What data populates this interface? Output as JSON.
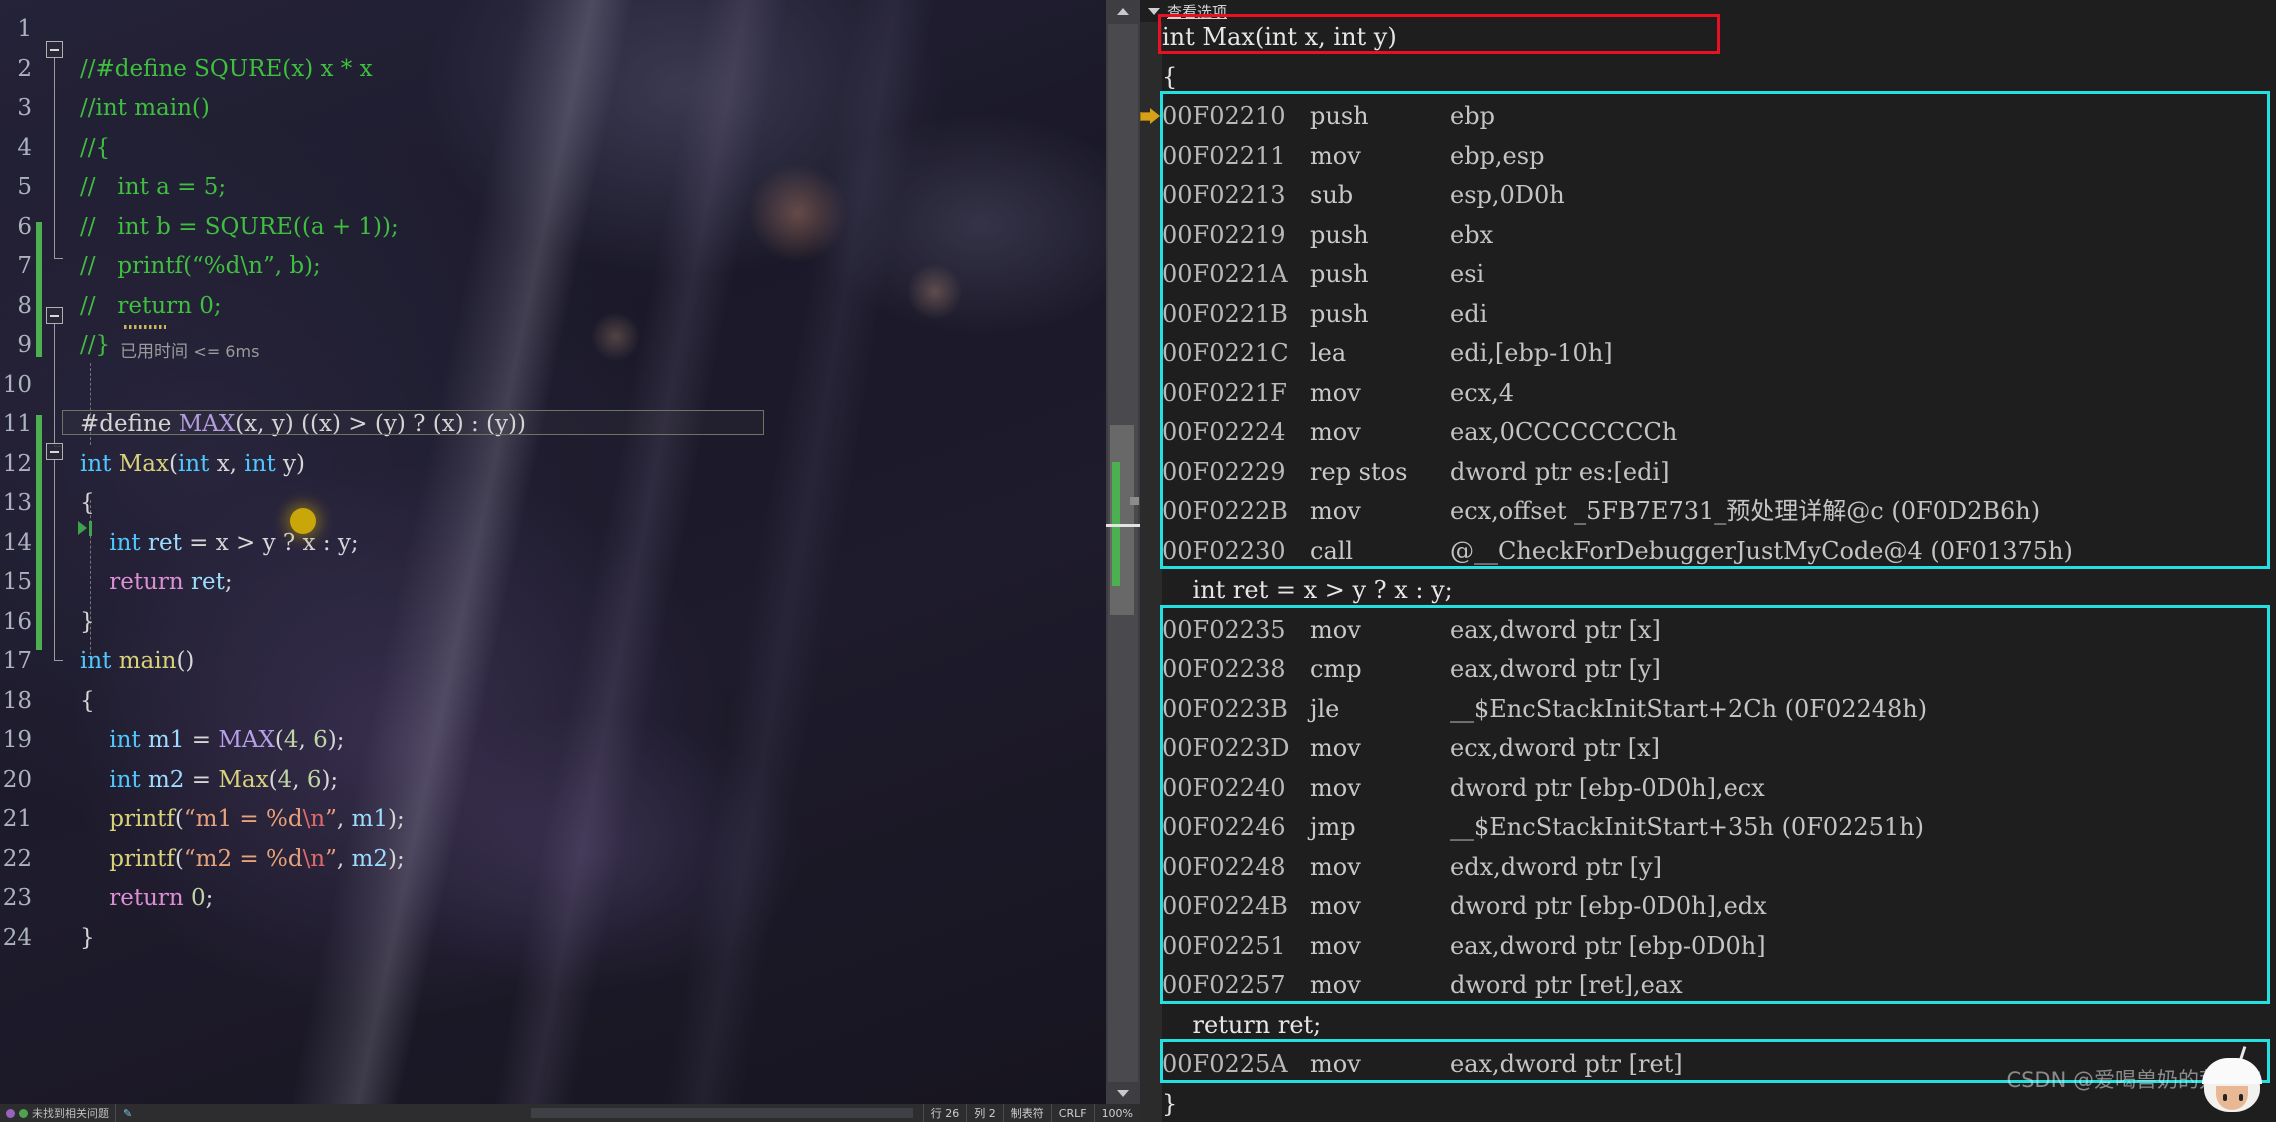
{
  "app": {
    "title": "Visual Studio Debugger",
    "accent_cyan": "#25e0e0",
    "accent_red": "#e81123",
    "change_bar_green": "#4caf50",
    "current_stmt_yellow": "#d8a018"
  },
  "editor": {
    "lines": [
      {
        "n": "1",
        "text": "",
        "tokens": []
      },
      {
        "n": "2",
        "tokens": [
          {
            "t": "//#define SQURE(x) x * x",
            "c": "cmt"
          }
        ]
      },
      {
        "n": "3",
        "tokens": [
          {
            "t": "//int main()",
            "c": "cmt"
          }
        ]
      },
      {
        "n": "4",
        "tokens": [
          {
            "t": "//{",
            "c": "cmt"
          }
        ]
      },
      {
        "n": "5",
        "tokens": [
          {
            "t": "//   int a = 5;",
            "c": "cmt"
          }
        ]
      },
      {
        "n": "6",
        "tokens": [
          {
            "t": "//   int b = SQURE((a + 1));",
            "c": "cmt"
          }
        ]
      },
      {
        "n": "7",
        "tokens": [
          {
            "t": "//   printf(“%d\\n”, b);",
            "c": "cmt"
          }
        ]
      },
      {
        "n": "8",
        "tokens": [
          {
            "t": "//   return 0;",
            "c": "cmt"
          }
        ]
      },
      {
        "n": "9",
        "tokens": [
          {
            "t": "//}",
            "c": "cmt"
          }
        ]
      },
      {
        "n": "10",
        "tokens": []
      },
      {
        "n": "11",
        "tokens": [
          {
            "t": "#define ",
            "c": "wht"
          },
          {
            "t": "MAX",
            "c": "mac"
          },
          {
            "t": "(x, y) ((x) > (y) ? (x) : (y))",
            "c": "wht"
          }
        ]
      },
      {
        "n": "12",
        "tokens": [
          {
            "t": "int ",
            "c": "kw"
          },
          {
            "t": "Max",
            "c": "fn"
          },
          {
            "t": "(",
            "c": "pln"
          },
          {
            "t": "int ",
            "c": "kw"
          },
          {
            "t": "x, ",
            "c": "pln"
          },
          {
            "t": "int ",
            "c": "kw"
          },
          {
            "t": "y)",
            "c": "pln"
          }
        ]
      },
      {
        "n": "13",
        "tokens": [
          {
            "t": "{",
            "c": "pln"
          }
        ]
      },
      {
        "n": "14",
        "tokens": [
          {
            "t": "    int ",
            "c": "kw"
          },
          {
            "t": "ret",
            "c": "id"
          },
          {
            "t": " = x > y ? x : y;",
            "c": "pln"
          }
        ]
      },
      {
        "n": "15",
        "tokens": [
          {
            "t": "    return",
            "c": "ret"
          },
          {
            "t": " ",
            "c": "pln"
          },
          {
            "t": "ret",
            "c": "id"
          },
          {
            "t": ";",
            "c": "pln"
          }
        ]
      },
      {
        "n": "16",
        "tokens": [
          {
            "t": "}",
            "c": "pln"
          }
        ]
      },
      {
        "n": "17",
        "tokens": [
          {
            "t": "int ",
            "c": "kw"
          },
          {
            "t": "main",
            "c": "fn"
          },
          {
            "t": "()",
            "c": "pln"
          }
        ]
      },
      {
        "n": "18",
        "tokens": [
          {
            "t": "{",
            "c": "pln"
          }
        ]
      },
      {
        "n": "19",
        "tokens": [
          {
            "t": "    int ",
            "c": "kw"
          },
          {
            "t": "m1",
            "c": "id"
          },
          {
            "t": " = ",
            "c": "pln"
          },
          {
            "t": "MAX",
            "c": "mac"
          },
          {
            "t": "(",
            "c": "pln"
          },
          {
            "t": "4",
            "c": "num"
          },
          {
            "t": ", ",
            "c": "pln"
          },
          {
            "t": "6",
            "c": "num"
          },
          {
            "t": ");",
            "c": "pln"
          }
        ]
      },
      {
        "n": "20",
        "tokens": [
          {
            "t": "    int ",
            "c": "kw"
          },
          {
            "t": "m2",
            "c": "id"
          },
          {
            "t": " = ",
            "c": "pln"
          },
          {
            "t": "Max",
            "c": "fn"
          },
          {
            "t": "(",
            "c": "pln"
          },
          {
            "t": "4",
            "c": "num"
          },
          {
            "t": ", ",
            "c": "pln"
          },
          {
            "t": "6",
            "c": "num"
          },
          {
            "t": ");",
            "c": "pln"
          }
        ]
      },
      {
        "n": "21",
        "tokens": [
          {
            "t": "    printf",
            "c": "fn"
          },
          {
            "t": "(",
            "c": "pln"
          },
          {
            "t": "“m1 = %d",
            "c": "str"
          },
          {
            "t": "\\n",
            "c": "esc"
          },
          {
            "t": "”",
            "c": "str"
          },
          {
            "t": ", ",
            "c": "pln"
          },
          {
            "t": "m1",
            "c": "id"
          },
          {
            "t": ");",
            "c": "pln"
          }
        ]
      },
      {
        "n": "22",
        "tokens": [
          {
            "t": "    printf",
            "c": "fn"
          },
          {
            "t": "(",
            "c": "pln"
          },
          {
            "t": "“m2 = %d",
            "c": "str"
          },
          {
            "t": "\\n",
            "c": "esc"
          },
          {
            "t": "”",
            "c": "str"
          },
          {
            "t": ", ",
            "c": "pln"
          },
          {
            "t": "m2",
            "c": "id"
          },
          {
            "t": ");",
            "c": "pln"
          }
        ]
      },
      {
        "n": "23",
        "tokens": [
          {
            "t": "    return",
            "c": "ret"
          },
          {
            "t": " ",
            "c": "pln"
          },
          {
            "t": "0",
            "c": "num"
          },
          {
            "t": ";",
            "c": "pln"
          }
        ]
      },
      {
        "n": "24",
        "tokens": [
          {
            "t": "}",
            "c": "pln"
          }
        ]
      }
    ],
    "elapsed_hint": "已用时间",
    "elapsed_value": "<= 6ms"
  },
  "disassembly": {
    "view_options_label": "查看选项",
    "blocks": [
      {
        "kind": "source",
        "text": "int Max(int x, int y)",
        "highlight": "red"
      },
      {
        "kind": "source",
        "text": "{"
      },
      {
        "kind": "asm",
        "highlight": "cyan",
        "rows": [
          {
            "addr": "00F02210",
            "mnemonic": "push",
            "operands": "ebp",
            "current": true
          },
          {
            "addr": "00F02211",
            "mnemonic": "mov",
            "operands": "ebp,esp"
          },
          {
            "addr": "00F02213",
            "mnemonic": "sub",
            "operands": "esp,0D0h"
          },
          {
            "addr": "00F02219",
            "mnemonic": "push",
            "operands": "ebx"
          },
          {
            "addr": "00F0221A",
            "mnemonic": "push",
            "operands": "esi"
          },
          {
            "addr": "00F0221B",
            "mnemonic": "push",
            "operands": "edi"
          },
          {
            "addr": "00F0221C",
            "mnemonic": "lea",
            "operands": "edi,[ebp-10h]"
          },
          {
            "addr": "00F0221F",
            "mnemonic": "mov",
            "operands": "ecx,4"
          },
          {
            "addr": "00F02224",
            "mnemonic": "mov",
            "operands": "eax,0CCCCCCCCh"
          },
          {
            "addr": "00F02229",
            "mnemonic": "rep stos",
            "operands": "dword ptr es:[edi]"
          },
          {
            "addr": "00F0222B",
            "mnemonic": "mov",
            "operands": "ecx,offset _5FB7E731_预处理详解@c (0F0D2B6h)"
          },
          {
            "addr": "00F02230",
            "mnemonic": "call",
            "operands": "@__CheckForDebuggerJustMyCode@4 (0F01375h)"
          }
        ]
      },
      {
        "kind": "source",
        "text": "    int ret = x > y ? x : y;"
      },
      {
        "kind": "asm",
        "highlight": "cyan",
        "rows": [
          {
            "addr": "00F02235",
            "mnemonic": "mov",
            "operands": "eax,dword ptr [x]"
          },
          {
            "addr": "00F02238",
            "mnemonic": "cmp",
            "operands": "eax,dword ptr [y]"
          },
          {
            "addr": "00F0223B",
            "mnemonic": "jle",
            "operands": "__$EncStackInitStart+2Ch (0F02248h)"
          },
          {
            "addr": "00F0223D",
            "mnemonic": "mov",
            "operands": "ecx,dword ptr [x]"
          },
          {
            "addr": "00F02240",
            "mnemonic": "mov",
            "operands": "dword ptr [ebp-0D0h],ecx"
          },
          {
            "addr": "00F02246",
            "mnemonic": "jmp",
            "operands": "__$EncStackInitStart+35h (0F02251h)"
          },
          {
            "addr": "00F02248",
            "mnemonic": "mov",
            "operands": "edx,dword ptr [y]"
          },
          {
            "addr": "00F0224B",
            "mnemonic": "mov",
            "operands": "dword ptr [ebp-0D0h],edx"
          },
          {
            "addr": "00F02251",
            "mnemonic": "mov",
            "operands": "eax,dword ptr [ebp-0D0h]"
          },
          {
            "addr": "00F02257",
            "mnemonic": "mov",
            "operands": "dword ptr [ret],eax"
          }
        ]
      },
      {
        "kind": "source",
        "text": "    return ret;"
      },
      {
        "kind": "asm",
        "highlight": "cyan",
        "rows": [
          {
            "addr": "00F0225A",
            "mnemonic": "mov",
            "operands": "eax,dword ptr [ret]"
          }
        ]
      },
      {
        "kind": "source",
        "text": "}"
      }
    ]
  },
  "watermark": "CSDN @爱喝兽奶的荒天帝",
  "statusbar": {
    "task_label": "未找到相关问题",
    "line": "行 26",
    "col": "列 2",
    "tabs": "制表符",
    "eol": "CRLF",
    "encoding": "100%"
  }
}
